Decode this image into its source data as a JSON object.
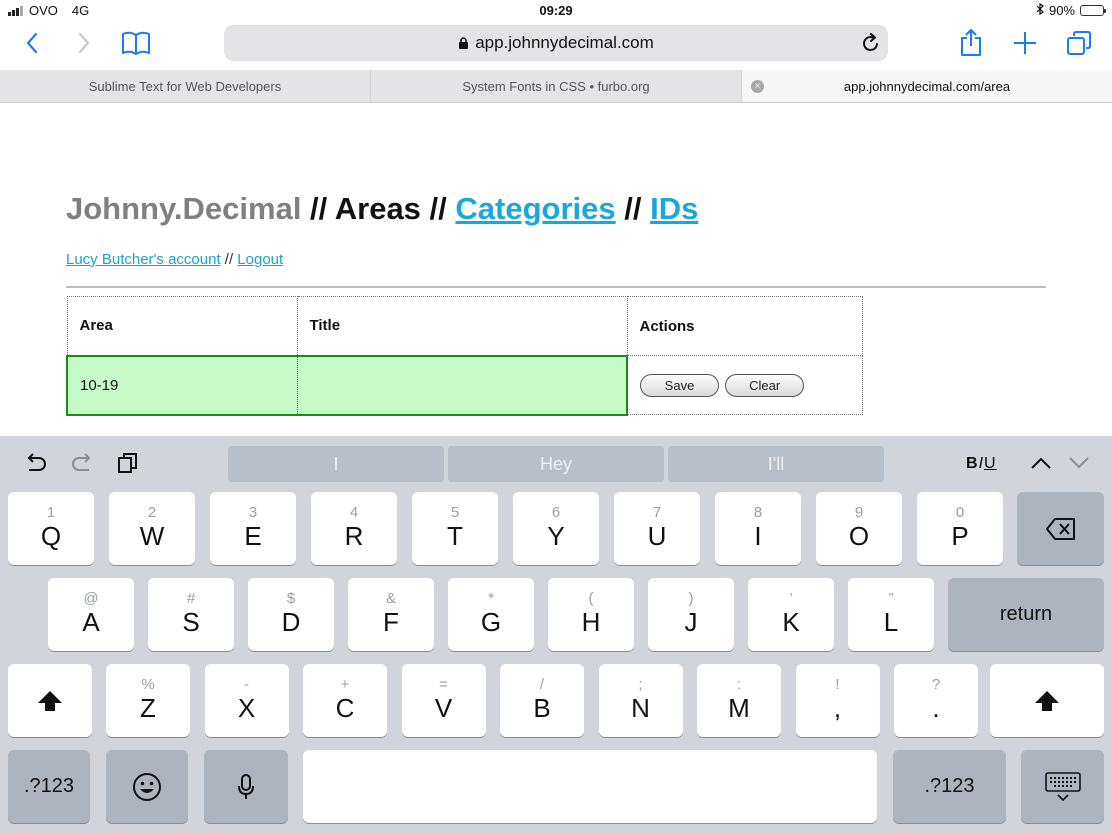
{
  "status": {
    "carrier": "OVO",
    "network": "4G",
    "time": "09:29",
    "battery": "90%",
    "battery_level": 0.9
  },
  "browser": {
    "url": "app.johnnydecimal.com",
    "tabs": [
      {
        "title": "Sublime Text for Web Developers"
      },
      {
        "title": "System Fonts in CSS • furbo.org"
      },
      {
        "title": "app.johnnydecimal.com/area"
      }
    ]
  },
  "page": {
    "heading": {
      "brand": "Johnny.Decimal",
      "sep1": " // ",
      "current": "Areas",
      "sep2": " // ",
      "link1": "Categories",
      "sep3": " // ",
      "link2": "IDs"
    },
    "account": {
      "account_link": "Lucy Butcher's account",
      "sep": " // ",
      "logout_link": "Logout"
    },
    "table": {
      "headers": [
        "Area",
        "Title",
        "Actions"
      ],
      "row": {
        "area": "10-19",
        "title": "",
        "save_label": "Save",
        "clear_label": "Clear"
      }
    }
  },
  "keyboard": {
    "suggestions": [
      "I",
      "Hey",
      "I'll"
    ],
    "format_label": "BIU",
    "row1": [
      {
        "hint": "1",
        "key": "Q"
      },
      {
        "hint": "2",
        "key": "W"
      },
      {
        "hint": "3",
        "key": "E"
      },
      {
        "hint": "4",
        "key": "R"
      },
      {
        "hint": "5",
        "key": "T"
      },
      {
        "hint": "6",
        "key": "Y"
      },
      {
        "hint": "7",
        "key": "U"
      },
      {
        "hint": "8",
        "key": "I"
      },
      {
        "hint": "9",
        "key": "O"
      },
      {
        "hint": "0",
        "key": "P"
      }
    ],
    "row2": [
      {
        "hint": "@",
        "key": "A"
      },
      {
        "hint": "#",
        "key": "S"
      },
      {
        "hint": "$",
        "key": "D"
      },
      {
        "hint": "&",
        "key": "F"
      },
      {
        "hint": "*",
        "key": "G"
      },
      {
        "hint": "(",
        "key": "H"
      },
      {
        "hint": ")",
        "key": "J"
      },
      {
        "hint": "’",
        "key": "K"
      },
      {
        "hint": "”",
        "key": "L"
      }
    ],
    "row3": [
      {
        "hint": "%",
        "key": "Z"
      },
      {
        "hint": "-",
        "key": "X"
      },
      {
        "hint": "+",
        "key": "C"
      },
      {
        "hint": "=",
        "key": "V"
      },
      {
        "hint": "/",
        "key": "B"
      },
      {
        "hint": ";",
        "key": "N"
      },
      {
        "hint": ":",
        "key": "M"
      },
      {
        "hint": "!",
        "key": ","
      },
      {
        "hint": "?",
        "key": "."
      }
    ],
    "return_label": "return",
    "numbers_label": ".?123",
    "icons": [
      "undo-icon",
      "redo-icon",
      "paste-icon",
      "chevron-up-icon",
      "chevron-down-icon",
      "delete-icon",
      "shift-icon",
      "emoji-icon",
      "mic-icon",
      "hide-keyboard-icon"
    ]
  }
}
